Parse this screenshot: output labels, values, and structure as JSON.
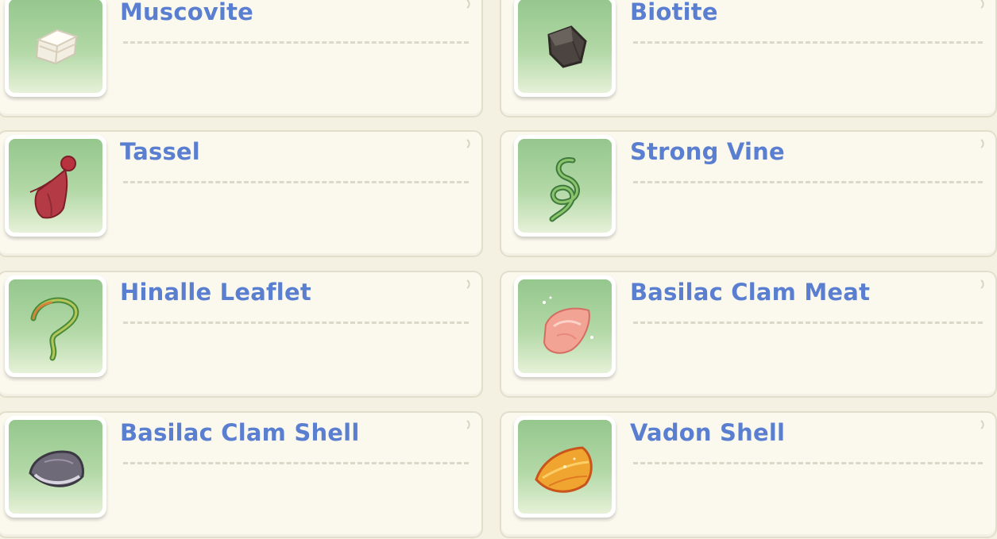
{
  "items": [
    {
      "name": "Muscovite",
      "icon": "muscovite-icon"
    },
    {
      "name": "Biotite",
      "icon": "biotite-icon"
    },
    {
      "name": "Tassel",
      "icon": "tassel-icon"
    },
    {
      "name": "Strong Vine",
      "icon": "strong-vine-icon"
    },
    {
      "name": "Hinalle Leaflet",
      "icon": "hinalle-leaflet-icon"
    },
    {
      "name": "Basilac Clam Meat",
      "icon": "clam-meat-icon"
    },
    {
      "name": "Basilac Clam Shell",
      "icon": "clam-shell-icon"
    },
    {
      "name": "Vadon Shell",
      "icon": "vadon-shell-icon"
    }
  ],
  "colors": {
    "name_text": "#5b7fd0",
    "card_bg": "#fbf9ee",
    "icon_bg": "#a6d29a"
  }
}
